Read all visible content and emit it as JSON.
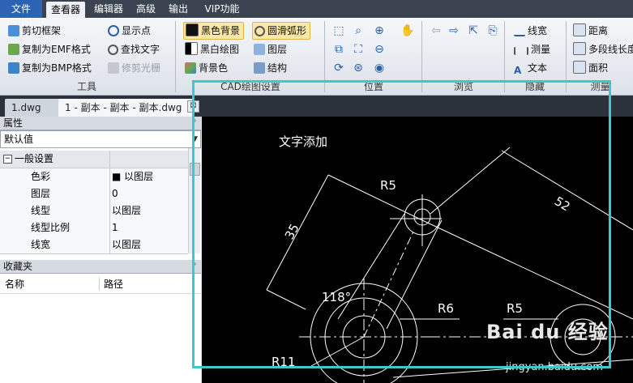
{
  "menu": {
    "file": "文件",
    "viewer": "查看器",
    "editor": "编辑器",
    "advanced": "高级",
    "output": "输出",
    "vip": "VIP功能"
  },
  "ribbon": {
    "tools": {
      "group": "工具",
      "cut_frame": "剪切框架",
      "copy_emf": "复制为EMF格式",
      "copy_bmp": "复制为BMP格式",
      "show_points": "显示点",
      "find_text": "查找文字",
      "trim_raster": "修剪光栅"
    },
    "cad_settings": {
      "group": "CAD绘图设置",
      "black_bg": "黑色背景",
      "bw_drawing": "黑白绘图",
      "bg_color": "背景色",
      "smooth_arc": "圆滑弧形",
      "layers": "图层",
      "structure": "结构"
    },
    "position": {
      "group": "位置"
    },
    "browse": {
      "group": "浏览"
    },
    "hide": {
      "group": "隐藏",
      "line_width": "线宽",
      "measure": "测量",
      "text": "文本"
    },
    "measure": {
      "group": "测量",
      "distance": "距离",
      "polyline_length": "多段线长度",
      "area": "面积"
    }
  },
  "tabs": {
    "tab1": "1.dwg",
    "tab2": "1 - 副本 - 副本 - 副本.dwg",
    "close": "⊠"
  },
  "properties": {
    "title": "属性",
    "preset": "默认值",
    "section": "一般设置",
    "rows": [
      {
        "key": "色彩",
        "value": "■ 以图层"
      },
      {
        "key": "图层",
        "value": "0"
      },
      {
        "key": "线型",
        "value": "以图层"
      },
      {
        "key": "线型比例",
        "value": "1"
      },
      {
        "key": "线宽",
        "value": "以图层"
      }
    ]
  },
  "favorites": {
    "title": "收藏夹",
    "col_name": "名称",
    "col_path": "路径"
  },
  "drawing": {
    "text_added": "文字添加",
    "dim_r5_top": "R5",
    "dim_52": "52",
    "dim_35": "35",
    "dim_118": "118°",
    "dim_r6": "R6",
    "dim_r5_right": "R5",
    "dim_r11": "R11"
  },
  "watermark": {
    "main": "Bai du 经验",
    "url": "jingyan.baidu.com"
  },
  "colors": {
    "menubar": "#3b4350",
    "file_menu": "#2c64b3",
    "canvas": "#000000",
    "highlight": "#3ec9c9"
  }
}
